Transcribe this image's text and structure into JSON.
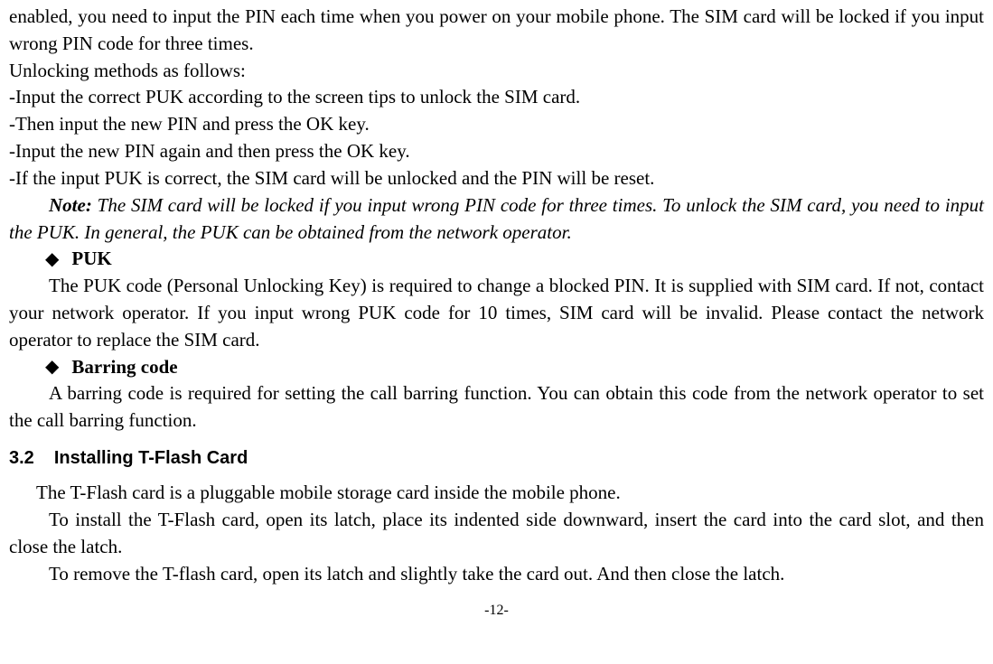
{
  "paragraphs": {
    "p1": "enabled, you need to input the PIN each time when you power on your mobile phone. The SIM card will be locked if you input wrong PIN code for three times.",
    "p2": "Unlocking methods as follows:",
    "p3": "-Input the correct PUK according to the screen tips to unlock the SIM card.",
    "p4": "-Then input the new PIN and press the OK key.",
    "p5": "-Input the new PIN again and then press the OK key.",
    "p6": "-If the input PUK is correct, the SIM card will be unlocked and the PIN will be reset."
  },
  "note": {
    "label": "Note:",
    "text": " The SIM card will be locked if you input wrong PIN code for three times. To unlock the SIM card, you need to input the PUK. In general, the PUK can be obtained from the network operator."
  },
  "bullets": {
    "puk": {
      "title": "PUK",
      "body": "The PUK code (Personal Unlocking Key) is required to change a blocked PIN. It is supplied with SIM card. If not, contact your network operator. If you input wrong PUK code for 10 times, SIM card will be invalid. Please contact the network operator to replace the SIM card."
    },
    "barring": {
      "title": "Barring code",
      "body": "A barring code is required for setting the call barring function. You can obtain this code from the network operator to set the call barring function."
    }
  },
  "section": {
    "number": "3.2",
    "title": "Installing T-Flash Card"
  },
  "tflash": {
    "p1": "The T-Flash card is a pluggable mobile storage card inside the mobile phone.",
    "p2": "To install the T-Flash card, open its latch, place its indented side downward, insert the card into the card slot, and then close the latch.",
    "p3": "To remove the T-flash card, open its latch and slightly take the card out. And then close the latch."
  },
  "pageNumber": "-12-"
}
